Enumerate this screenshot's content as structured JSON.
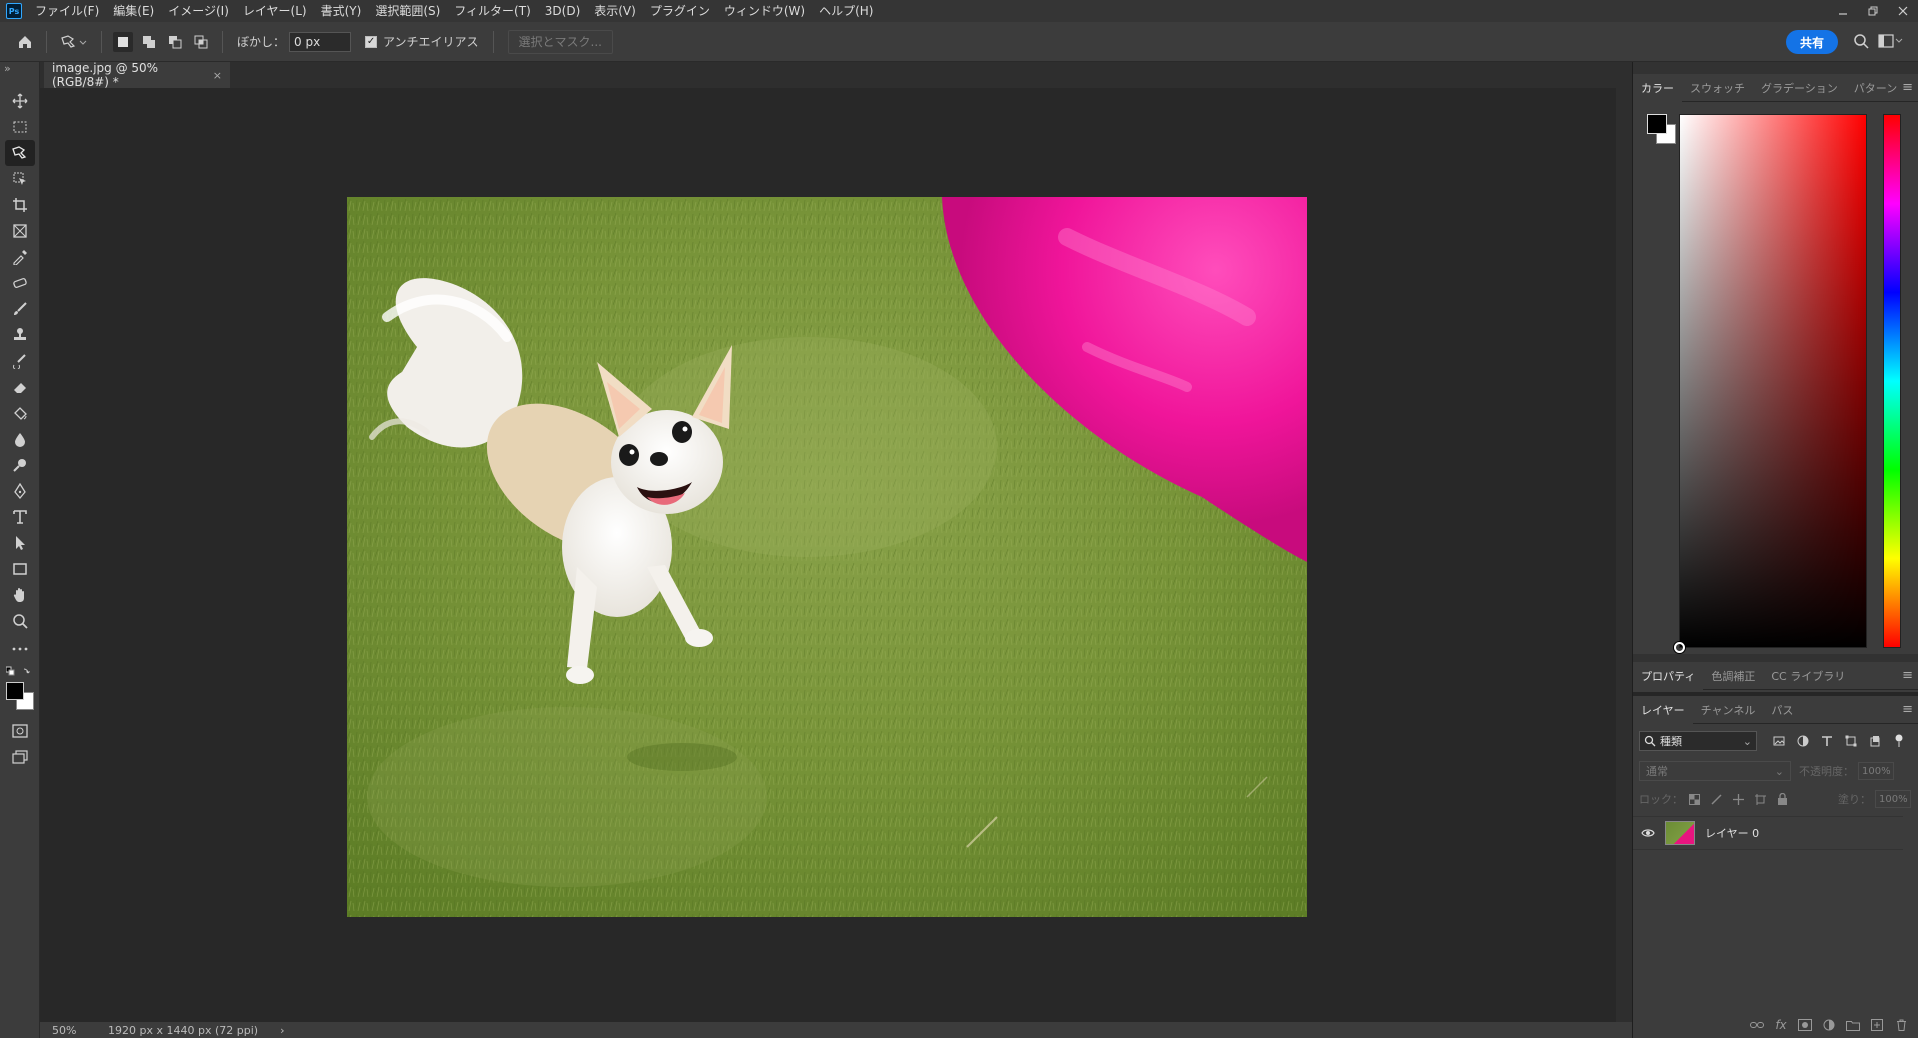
{
  "app": {
    "logo": "Ps"
  },
  "menu": [
    "ファイル(F)",
    "編集(E)",
    "イメージ(I)",
    "レイヤー(L)",
    "書式(Y)",
    "選択範囲(S)",
    "フィルター(T)",
    "3D(D)",
    "表示(V)",
    "プラグイン",
    "ウィンドウ(W)",
    "ヘルプ(H)"
  ],
  "options": {
    "feather_label": "ぼかし：",
    "feather_value": "0 px",
    "antialias_label": "アンチエイリアス",
    "antialias_checked": true,
    "mask_button": "選択とマスク...",
    "share_button": "共有"
  },
  "document": {
    "tab_title": "image.jpg @ 50% (RGB/8#) *",
    "close": "×"
  },
  "status": {
    "zoom": "50%",
    "info": "1920 px x 1440 px (72 ppi)",
    "arrow": "›"
  },
  "color_panel": {
    "tabs": [
      "カラー",
      "スウォッチ",
      "グラデーション",
      "パターン"
    ],
    "foreground": "#000000",
    "background": "#ffffff",
    "hue": "#ff0000"
  },
  "properties_panel": {
    "tabs": [
      "プロパティ",
      "色調補正",
      "CC ライブラリ"
    ]
  },
  "layers_panel": {
    "tabs": [
      "レイヤー",
      "チャンネル",
      "パス"
    ],
    "kind_filter": "種類",
    "blend_mode": "通常",
    "opacity_label": "不透明度：",
    "opacity_value": "100%",
    "lock_label": "ロック：",
    "fill_label": "塗り：",
    "fill_value": "100%",
    "layers": [
      {
        "name": "レイヤー 0",
        "visible": true
      }
    ]
  }
}
